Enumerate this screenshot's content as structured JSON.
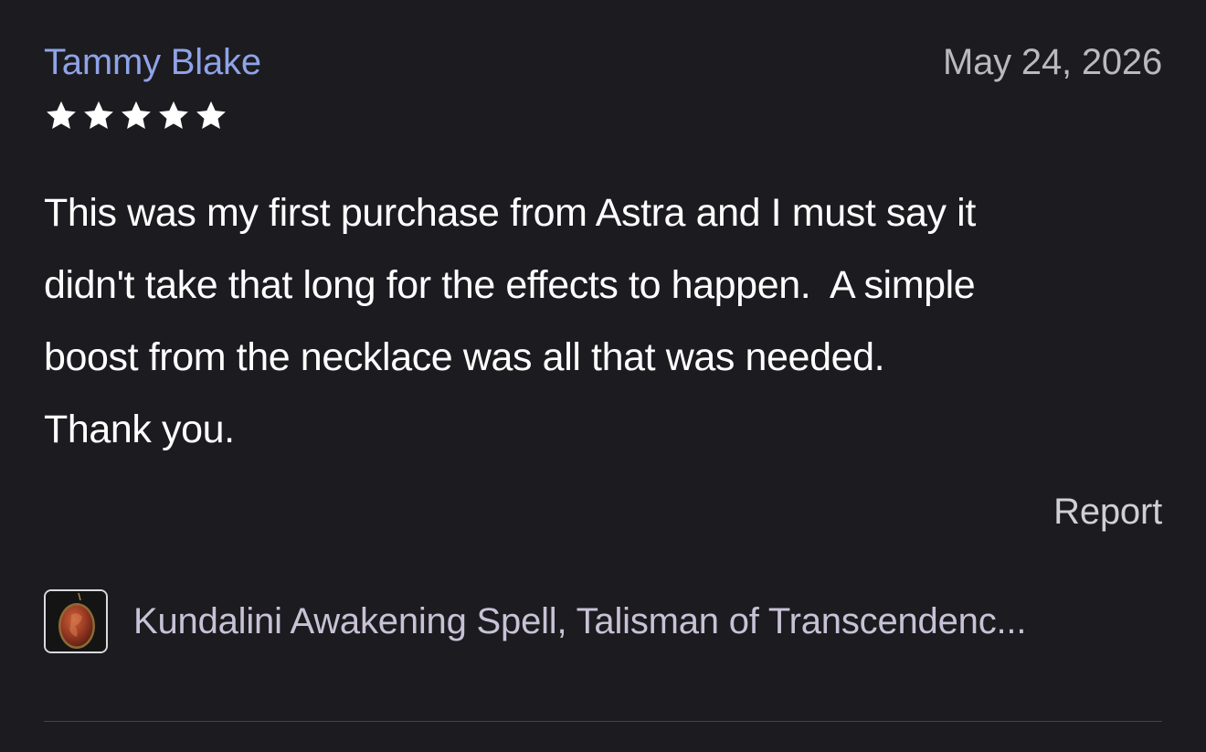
{
  "review": {
    "reviewer_name": "Tammy Blake",
    "date": "May 24, 2026",
    "rating": 5,
    "rating_max": 5,
    "body": "This was my first purchase from Astra and I must say it\ndidn't take that long for the effects to happen.  A simple\nboost from the necklace was all that was needed.\nThank you.",
    "report_label": "Report",
    "product": {
      "title": "Kundalini Awakening Spell, Talisman of Transcendenc...",
      "thumbnail_icon": "carnelian-pendant-thumbnail"
    }
  },
  "colors": {
    "background": "#1c1b1f",
    "reviewer_name": "#8fa3e8",
    "date": "#b9b9bf",
    "body_text": "#ffffff",
    "report": "#cfcfd4",
    "product_title": "#c8c2d6",
    "star": "#ffffff",
    "divider": "#44434a"
  }
}
